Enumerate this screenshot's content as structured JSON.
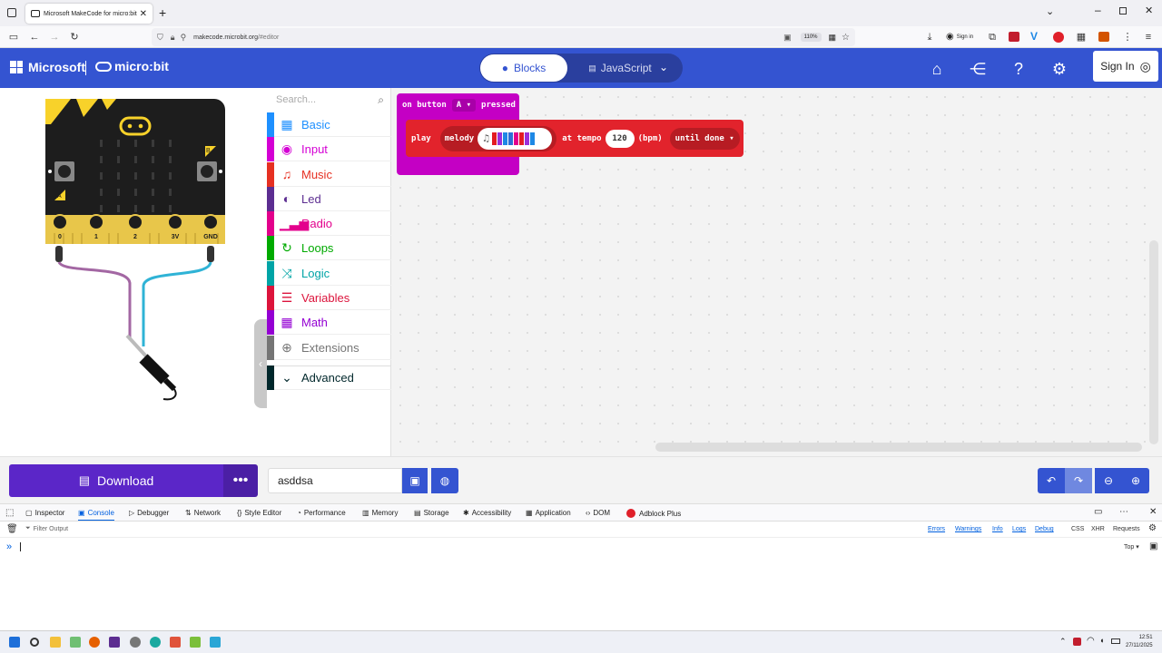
{
  "browser": {
    "tab_title": "Microsoft MakeCode for micro:bit",
    "url_host": "makecode.microbit.org",
    "url_path": "/#editor",
    "zoom": "110%",
    "sign_in": "Sign in"
  },
  "header": {
    "microsoft": "Microsoft",
    "microbit": "micro:bit",
    "blocks_tab": "Blocks",
    "javascript_tab": "JavaScript",
    "sign_in": "Sign In"
  },
  "simulator": {
    "pin_labels": [
      "0",
      "1",
      "2",
      "3V",
      "GND"
    ],
    "button_a": "A",
    "button_b": "B"
  },
  "toolbox": {
    "search_placeholder": "Search...",
    "categories": [
      {
        "label": "Basic",
        "color": "#1e90ff",
        "icon": "grid-icon"
      },
      {
        "label": "Input",
        "color": "#d400d4",
        "icon": "input-icon"
      },
      {
        "label": "Music",
        "color": "#e63022",
        "icon": "headphones-icon"
      },
      {
        "label": "Led",
        "color": "#5c2d91",
        "icon": "toggle-icon"
      },
      {
        "label": "Radio",
        "color": "#e3008c",
        "icon": "signal-icon"
      },
      {
        "label": "Loops",
        "color": "#00aa00",
        "icon": "refresh-icon"
      },
      {
        "label": "Logic",
        "color": "#00a4a6",
        "icon": "shuffle-icon"
      },
      {
        "label": "Variables",
        "color": "#dc143c",
        "icon": "list-icon"
      },
      {
        "label": "Math",
        "color": "#9400d3",
        "icon": "calculator-icon"
      },
      {
        "label": "Extensions",
        "color": "#757575",
        "icon": "plus-icon"
      },
      {
        "label": "Advanced",
        "color": "#00272b",
        "icon": "chevron-down-icon"
      }
    ]
  },
  "workspace": {
    "event_block": {
      "prefix": "on button",
      "button": "A",
      "suffix": "pressed"
    },
    "play_block": {
      "play": "play",
      "melody": "melody",
      "at_tempo": "at tempo",
      "tempo": "120",
      "bpm": "(bpm)",
      "mode": "until done"
    }
  },
  "bottom": {
    "download": "Download",
    "more": "•••",
    "project_name": "asddsa"
  },
  "devtools": {
    "tabs": [
      "Inspector",
      "Console",
      "Debugger",
      "Network",
      "Style Editor",
      "Performance",
      "Memory",
      "Storage",
      "Accessibility",
      "Application",
      "DOM",
      "Adblock Plus"
    ],
    "active_tab": "Console",
    "filter_placeholder": "Filter Output",
    "filters": [
      "Errors",
      "Warnings",
      "Info",
      "Logs",
      "Debug"
    ],
    "extra_filters": [
      "CSS",
      "XHR",
      "Requests"
    ],
    "context": "Top"
  },
  "taskbar": {
    "time": "12:51",
    "date": "27/11/2025"
  }
}
